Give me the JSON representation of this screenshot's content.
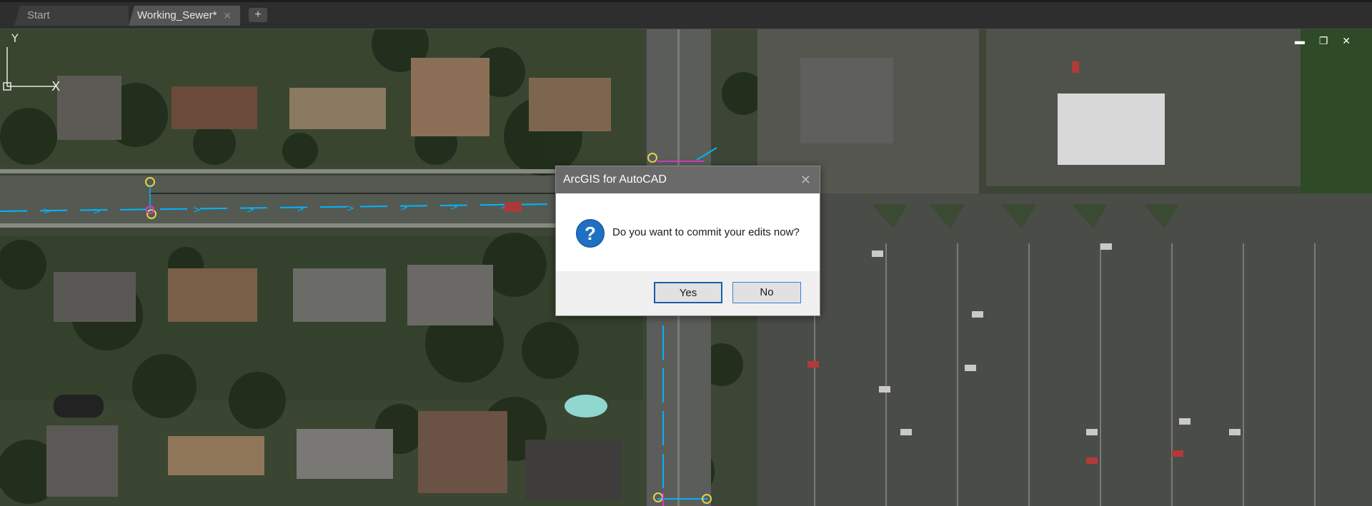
{
  "tabs": {
    "start_label": "Start",
    "active_label": "Working_Sewer*",
    "close_glyph": "✕",
    "add_glyph": "+"
  },
  "window_controls": {
    "minimize": "▬",
    "restore": "❐",
    "close": "✕"
  },
  "dialog": {
    "title": "ArcGIS for AutoCAD",
    "close_glyph": "✕",
    "icon_glyph": "?",
    "message": "Do you want to commit your edits now?",
    "yes_label": "Yes",
    "no_label": "No"
  },
  "ucs": {
    "x_label": "X",
    "y_label": "Y"
  },
  "colors": {
    "sewer_line": "#00b4ff",
    "manhole": "#e6d24a",
    "selected": "#d03cc8"
  }
}
